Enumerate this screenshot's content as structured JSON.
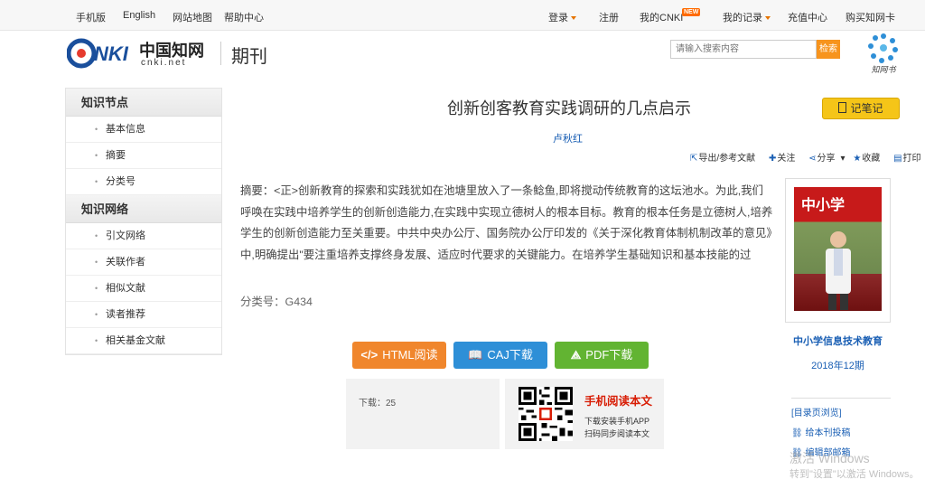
{
  "topbar": {
    "mobile": "手机版",
    "english": "English",
    "sitemap": "网站地图",
    "help": "帮助中心",
    "login": "登录",
    "register": "注册",
    "my_cnki": "我的CNKI",
    "new_badge": "NEW",
    "my_records": "我的记录",
    "recharge": "充值中心",
    "buy_card": "购买知网卡"
  },
  "header": {
    "logo_text": "中国知网",
    "logo_sub": "cnki.net",
    "section": "期刊",
    "search_placeholder": "请输入搜索内容",
    "search_button": "检索",
    "zwj_label": "知网书"
  },
  "sidebar": {
    "group1_title": "知识节点",
    "group1_items": [
      "基本信息",
      "摘要",
      "分类号"
    ],
    "group2_title": "知识网络",
    "group2_items": [
      "引文网络",
      "关联作者",
      "相似文献",
      "读者推荐",
      "相关基金文献"
    ]
  },
  "article": {
    "title": "创新创客教育实践调研的几点启示",
    "notes_button": "记笔记",
    "author": "卢秋红",
    "tools": {
      "export": "导出/参考文献",
      "follow": "关注",
      "share": "分享",
      "favorite": "收藏",
      "print": "打印"
    },
    "abstract": "摘要：<正>创新教育的探索和实践犹如在池塘里放入了一条鲶鱼,即将搅动传统教育的这坛池水。为此,我们呼唤在实践中培养学生的创新创造能力,在实践中实现立德树人的根本目标。教育的根本任务是立德树人,培养学生的创新创造能力至关重要。中共中央办公厅、国务院办公厅印发的《关于深化教育体制机制改革的意见》中,明确提出\"要注重培养支撑终身发展、适应时代要求的关键能力。在培养学生基础知识和基本技能的过",
    "class_no": "分类号：G434"
  },
  "downloads": {
    "html": "HTML阅读",
    "caj": "CAJ下载",
    "pdf": "PDF下载",
    "count": "下载：25"
  },
  "mobile": {
    "title": "手机阅读本文",
    "line1": "下载安装手机APP",
    "line2": "扫码同步阅读本文"
  },
  "journal": {
    "cover_title": "中小学",
    "name": "中小学信息技术教育",
    "issue": "2018年12期",
    "toc": "[目录页浏览]",
    "submit": "给本刊投稿",
    "editor": "编辑部邮箱"
  },
  "watermark": {
    "line1": "激活 Windows",
    "line2": "转到\"设置\"以激活 Windows。"
  },
  "colors": {
    "orange": "#f0862c",
    "blue": "#2e8fd7",
    "green": "#62b432",
    "link": "#1a5fb4",
    "red": "#d81e06"
  }
}
